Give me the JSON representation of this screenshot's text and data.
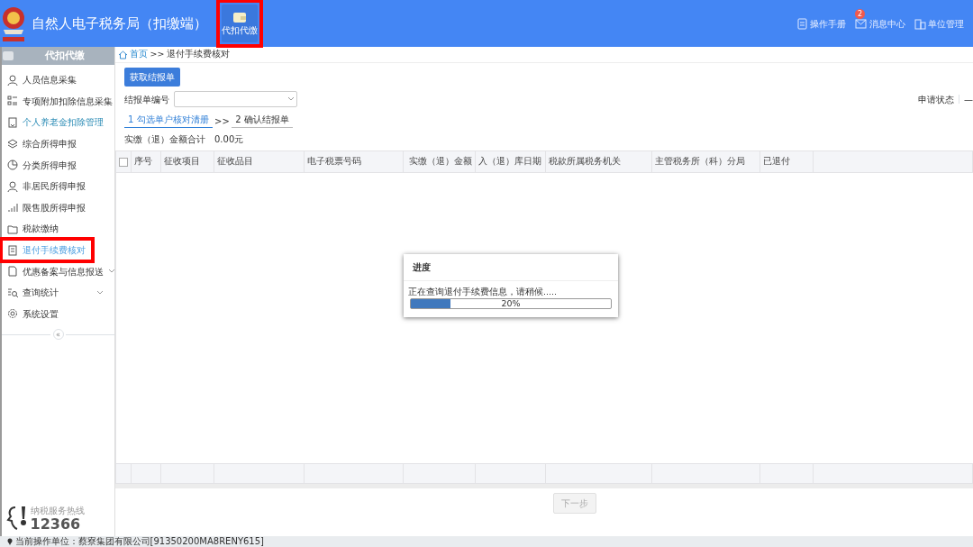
{
  "header": {
    "title": "自然人电子税务局（扣缴端）",
    "modules": [
      {
        "label": "代扣代缴",
        "selected": true,
        "highlighted": true
      }
    ],
    "links": [
      {
        "label": "操作手册"
      },
      {
        "label": "消息中心",
        "badge": "2"
      },
      {
        "label": "单位管理"
      }
    ]
  },
  "sidebar": {
    "title": "代扣代缴",
    "items": [
      {
        "label": "人员信息采集",
        "selected": false,
        "accent": false,
        "has_submenu": false,
        "highlighted": false
      },
      {
        "label": "专项附加扣除信息采集",
        "selected": false,
        "accent": false,
        "has_submenu": false,
        "highlighted": false
      },
      {
        "label": "个人养老金扣除管理",
        "selected": false,
        "accent": true,
        "has_submenu": false,
        "highlighted": false
      },
      {
        "label": "综合所得申报",
        "selected": false,
        "accent": false,
        "has_submenu": false,
        "highlighted": false
      },
      {
        "label": "分类所得申报",
        "selected": false,
        "accent": false,
        "has_submenu": false,
        "highlighted": false
      },
      {
        "label": "非居民所得申报",
        "selected": false,
        "accent": false,
        "has_submenu": false,
        "highlighted": false
      },
      {
        "label": "限售股所得申报",
        "selected": false,
        "accent": false,
        "has_submenu": false,
        "highlighted": false
      },
      {
        "label": "税款缴纳",
        "selected": false,
        "accent": false,
        "has_submenu": false,
        "highlighted": false
      },
      {
        "label": "退付手续费核对",
        "selected": true,
        "accent": false,
        "has_submenu": false,
        "highlighted": true
      },
      {
        "label": "优惠备案与信息报送",
        "selected": false,
        "accent": false,
        "has_submenu": true,
        "highlighted": false
      },
      {
        "label": "查询统计",
        "selected": false,
        "accent": false,
        "has_submenu": true,
        "highlighted": false
      },
      {
        "label": "系统设置",
        "selected": false,
        "accent": false,
        "has_submenu": false,
        "highlighted": false
      }
    ],
    "collapse": "«",
    "hotline": {
      "caption": "纳税服务热线",
      "number": "12366"
    }
  },
  "breadcrumb": [
    {
      "label": "首页",
      "link": true
    },
    {
      "label": ">>",
      "link": false
    },
    {
      "label": "退付手续费核对",
      "link": false
    }
  ],
  "toolbar": {
    "button": "获取结报单"
  },
  "filter": {
    "label": "结报单编号",
    "status_label": "申请状态",
    "status_value": "—"
  },
  "steps": [
    {
      "label": "1 勾选单户核对清册",
      "selected": true
    },
    {
      "label": "2 确认结报单",
      "selected": false
    }
  ],
  "step_separator": ">>",
  "total": {
    "label": "实缴（退）金额合计",
    "value": "0.00元"
  },
  "table": {
    "select_all_checked": false,
    "columns": [
      "序号",
      "征收项目",
      "征收品目",
      "电子税票号码",
      "实缴（退）金额",
      "入（退）库日期",
      "税款所属税务机关",
      "主管税务所（科）分局",
      "已退付"
    ]
  },
  "dialog": {
    "title": "进度",
    "message": "正在查询退付手续费信息，请稍候.....",
    "level": 0.2,
    "reading": "20%"
  },
  "next_button": {
    "label": "下一步",
    "disabled": true
  },
  "status_bar": "当前操作单位：蔡寮集团有限公司[91350200MA8RENY615]"
}
